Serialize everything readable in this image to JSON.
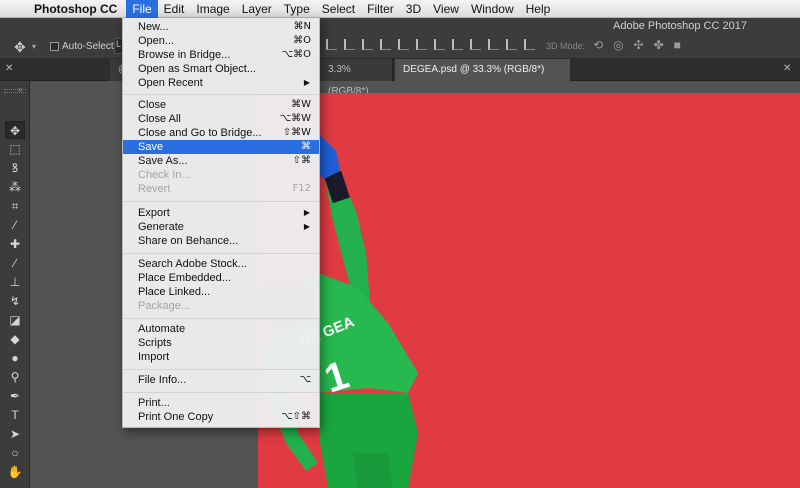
{
  "menubar": {
    "app_name": "Photoshop CC",
    "items": [
      "File",
      "Edit",
      "Image",
      "Layer",
      "Type",
      "Select",
      "Filter",
      "3D",
      "View",
      "Window",
      "Help"
    ]
  },
  "optionsbar": {
    "window_title": "Adobe Photoshop CC 2017",
    "auto_select_label": "Auto-Select:",
    "auto_select_value": "L",
    "mode_3d_label": "3D Mode:"
  },
  "tabs": [
    {
      "label": "@"
    },
    {
      "label": "3.3% (RGB/8*)"
    },
    {
      "label": "DEGEA.psd @ 33.3% (RGB/8*)"
    }
  ],
  "canvas": {
    "background_color": "#e03a42",
    "jersey_name": "DE GEA",
    "jersey_number": "1"
  },
  "file_menu": {
    "items": [
      {
        "label": "New...",
        "shortcut": "⌘N"
      },
      {
        "label": "Open...",
        "shortcut": "⌘O"
      },
      {
        "label": "Browse in Bridge...",
        "shortcut": "⌥⌘O"
      },
      {
        "label": "Open as Smart Object..."
      },
      {
        "label": "Open Recent"
      },
      {
        "label": "Close",
        "shortcut": "⌘W"
      },
      {
        "label": "Close All",
        "shortcut": "⌥⌘W"
      },
      {
        "label": "Close and Go to Bridge...",
        "shortcut": "⇧⌘W"
      },
      {
        "label": "Save",
        "shortcut": "⌘"
      },
      {
        "label": "Save As...",
        "shortcut": "⇧⌘"
      },
      {
        "label": "Check In..."
      },
      {
        "label": "Revert",
        "shortcut": "F12"
      },
      {
        "label": "Export"
      },
      {
        "label": "Generate"
      },
      {
        "label": "Share on Behance..."
      },
      {
        "label": "Search Adobe Stock..."
      },
      {
        "label": "Place Embedded..."
      },
      {
        "label": "Place Linked..."
      },
      {
        "label": "Package..."
      },
      {
        "label": "Automate"
      },
      {
        "label": "Scripts"
      },
      {
        "label": "Import"
      },
      {
        "label": "File Info...",
        "shortcut": "⌥"
      },
      {
        "label": "Print..."
      },
      {
        "label": "Print One Copy",
        "shortcut": "⌥⇧⌘"
      }
    ]
  }
}
